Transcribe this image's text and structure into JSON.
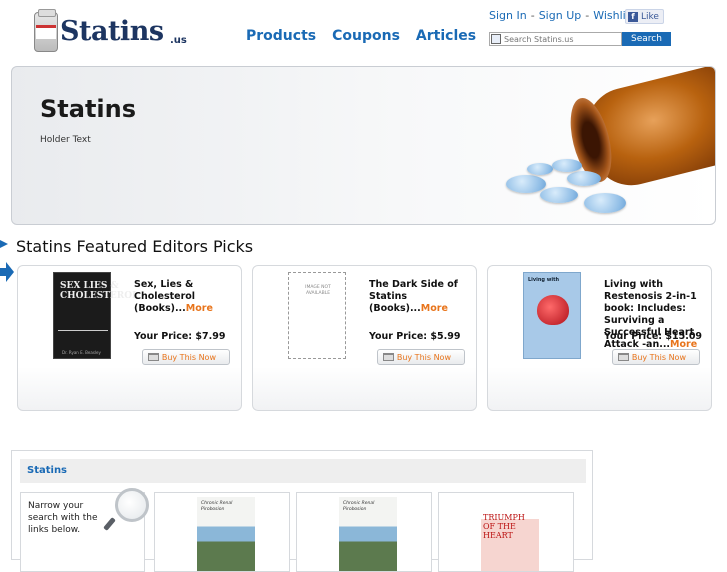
{
  "header": {
    "logo_text": "Statins",
    "logo_suffix": ".us",
    "nav": [
      "Products",
      "Coupons",
      "Articles"
    ],
    "sign_in": "Sign In",
    "sign_up": "Sign Up",
    "wishlist": "Wishlist",
    "separator": "-",
    "like": "Like",
    "search_placeholder": "Search Statins.us",
    "search_button": "Search"
  },
  "banner": {
    "title": "Statins",
    "subtitle": "Holder Text"
  },
  "featured": {
    "heading": "Statins Featured Editors Picks",
    "items": [
      {
        "name": "Sex, Lies & Cholesterol (Books)...",
        "more": "More",
        "price": "Your Price: $7.99",
        "buy": "Buy This Now",
        "cover_title": "SEX LIES & CHOLESTEROL",
        "cover_author": "Dr. Ryan E. Beasley"
      },
      {
        "name": "The Dark Side of Statins (Books)...",
        "more": "More",
        "price": "Your Price: $5.99",
        "buy": "Buy This Now",
        "cover_title": "IMAGE NOT AVAILABLE"
      },
      {
        "name": "Living with Restenosis 2-in-1 book: Includes: Surviving a Successful Heart Attack -an...",
        "more": "More",
        "price": "Your Price: $15.09",
        "buy": "Buy This Now",
        "cover_title": "Living with"
      }
    ]
  },
  "lower": {
    "heading": "Statins",
    "narrow_text": "Narrow your search with the links below.",
    "thumbs": [
      {
        "cover_title": "Chronic Renal Pirobosion"
      },
      {
        "cover_title": "Chronic Renal Pirobosion"
      },
      {
        "cover_title": "TRIUMPH OF THE HEART"
      }
    ]
  }
}
